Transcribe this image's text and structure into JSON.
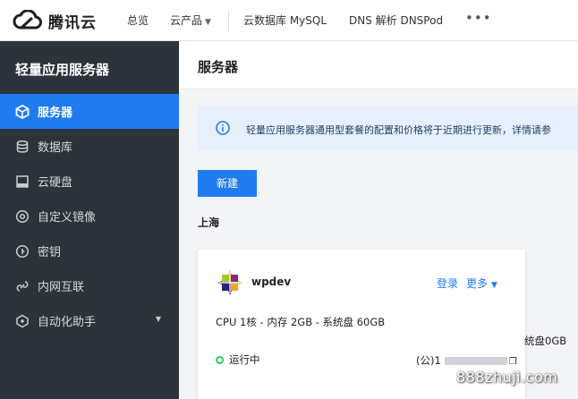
{
  "brand": {
    "name": "腾讯云"
  },
  "topnav": {
    "overview": "总览",
    "products": "云产品",
    "mysql": "云数据库 MySQL",
    "dnspod": "DNS 解析 DNSPod",
    "more": "•••"
  },
  "sidebar": {
    "title": "轻量应用服务器",
    "items": [
      {
        "label": "服务器",
        "icon": "cube-icon"
      },
      {
        "label": "数据库",
        "icon": "database-icon"
      },
      {
        "label": "云硬盘",
        "icon": "disk-icon"
      },
      {
        "label": "自定义镜像",
        "icon": "image-icon"
      },
      {
        "label": "密钥",
        "icon": "key-icon"
      },
      {
        "label": "内网互联",
        "icon": "link-icon"
      },
      {
        "label": "自动化助手",
        "icon": "robot-icon"
      }
    ]
  },
  "main": {
    "title": "服务器",
    "notice": "轻量应用服务器通用型套餐的配置和价格将于近期进行更新，详情请参",
    "new_button": "新建",
    "region": "上海",
    "card": {
      "name": "wpdev",
      "login": "登录",
      "more": "更多",
      "specs": "CPU 1核 - 内存 2GB - 系统盘 60GB",
      "status": "运行中",
      "ip_label": "(公)1",
      "ip_tail": "0"
    },
    "right_card_text": "统盘0GB"
  },
  "watermark": "888zhuji.com",
  "colors": {
    "accent": "#1f7cf0",
    "sidebar_bg": "#2d333b",
    "running": "#29cc6a"
  }
}
